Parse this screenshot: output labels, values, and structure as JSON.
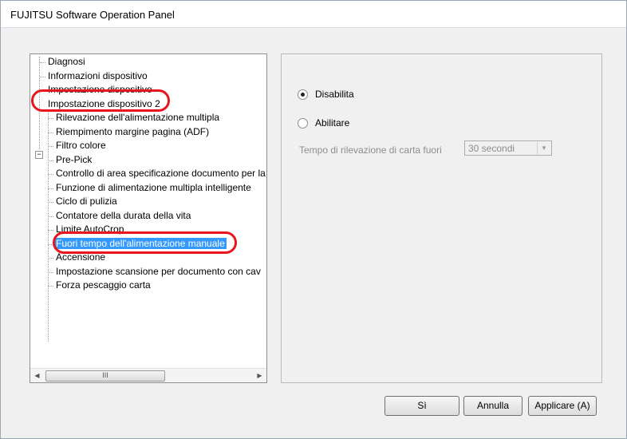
{
  "window": {
    "title": "FUJITSU Software Operation Panel"
  },
  "tree": {
    "items": [
      {
        "label": "Diagnosi"
      },
      {
        "label": "Informazioni dispositivo"
      },
      {
        "label": "Impostazione dispositivo"
      },
      {
        "label": "Impostazione dispositivo 2",
        "expanded": true
      },
      {
        "label": "Rilevazione dell'alimentazione multipla"
      },
      {
        "label": "Riempimento margine pagina (ADF)"
      },
      {
        "label": "Filtro colore"
      },
      {
        "label": "Pre-Pick"
      },
      {
        "label": "Controllo di area specificazione documento per la"
      },
      {
        "label": "Funzione di alimentazione multipla intelligente"
      },
      {
        "label": "Ciclo di pulizia"
      },
      {
        "label": "Contatore della durata della vita"
      },
      {
        "label": "Limite AutoCrop"
      },
      {
        "label": "Fuori tempo dell'alimentazione manuale",
        "selected": true
      },
      {
        "label": "Accensione"
      },
      {
        "label": "Impostazione scansione per documento con cav"
      },
      {
        "label": "Forza pescaggio carta"
      }
    ],
    "expander_symbol": "−",
    "scroll_grip": "III"
  },
  "settings": {
    "option_disable": "Disabilita",
    "option_enable": "Abilitare",
    "selected_option": "Disabilita",
    "timeout_label": "Tempo di rilevazione di carta fuori",
    "timeout_value": "30 secondi"
  },
  "buttons": {
    "ok": "Sì",
    "cancel": "Annulla",
    "apply": "Applicare (A)"
  },
  "highlight_color": "#e8161c"
}
